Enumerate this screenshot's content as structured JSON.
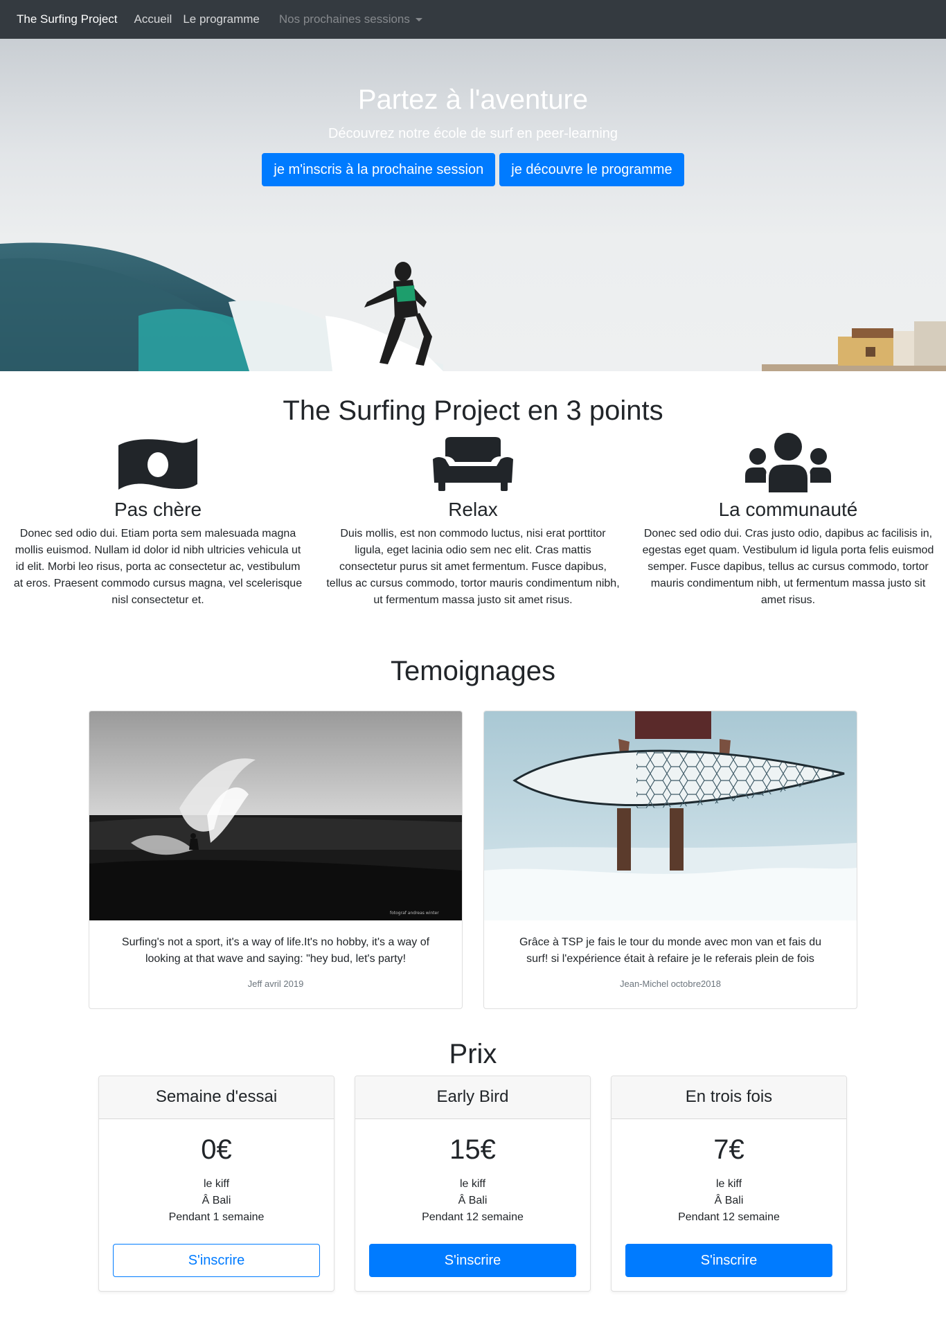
{
  "navbar": {
    "brand": "The Surfing Project",
    "links": [
      "Accueil",
      "Le programme"
    ],
    "dropdown": "Nos prochaines sessions"
  },
  "hero": {
    "title": "Partez à l'aventure",
    "subtitle": "Découvrez notre école de surf en peer-learning",
    "btn_register": "je m'inscris à la prochaine session",
    "btn_program": "je découvre le programme"
  },
  "points": {
    "title": "The Surfing Project en 3 points",
    "items": [
      {
        "icon": "money-bill-icon",
        "title": "Pas chère",
        "text": "Donec sed odio dui. Etiam porta sem malesuada magna mollis euismod. Nullam id dolor id nibh ultricies vehicula ut id elit. Morbi leo risus, porta ac consectetur ac, vestibulum at eros. Praesent commodo cursus magna, vel scelerisque nisl consectetur et."
      },
      {
        "icon": "couch-icon",
        "title": "Relax",
        "text": "Duis mollis, est non commodo luctus, nisi erat porttitor ligula, eget lacinia odio sem nec elit. Cras mattis consectetur purus sit amet fermentum. Fusce dapibus, tellus ac cursus commodo, tortor mauris condimentum nibh, ut fermentum massa justo sit amet risus."
      },
      {
        "icon": "users-icon",
        "title": "La communauté",
        "text": "Donec sed odio dui. Cras justo odio, dapibus ac facilisis in, egestas eget quam. Vestibulum id ligula porta felis euismod semper. Fusce dapibus, tellus ac cursus commodo, tortor mauris condimentum nibh, ut fermentum massa justo sit amet risus."
      }
    ]
  },
  "testimonials": {
    "title": "Temoignages",
    "items": [
      {
        "quote": "Surfing's not a sport, it's a way of life.It's no hobby, it's a way of looking at that wave and saying: \"hey bud, let's party!",
        "author": "Jeff avril 2019",
        "photo_credit": "fotograf andreas winter"
      },
      {
        "quote": "Grâce à TSP je fais le tour du monde avec mon van et fais du surf! si l'expérience était à refaire je le referais plein de fois",
        "author": "Jean-Michel octobre2018"
      }
    ]
  },
  "pricing": {
    "title": "Prix",
    "plans": [
      {
        "name": "Semaine d'essai",
        "price": "0€",
        "features": [
          "le kiff",
          "Â Bali",
          "Pendant 1 semaine"
        ],
        "button": "S'inscrire"
      },
      {
        "name": "Early Bird",
        "price": "15€",
        "features": [
          "le kiff",
          "Â Bali",
          "Pendant 12 semaine"
        ],
        "button": "S'inscrire"
      },
      {
        "name": "En trois fois",
        "price": "7€",
        "features": [
          "le kiff",
          "Â Bali",
          "Pendant 12 semaine"
        ],
        "button": "S'inscrire"
      }
    ]
  },
  "colors": {
    "navbar": "#343a40",
    "primary": "#007bff",
    "text": "#212529",
    "muted": "#6c757d"
  }
}
